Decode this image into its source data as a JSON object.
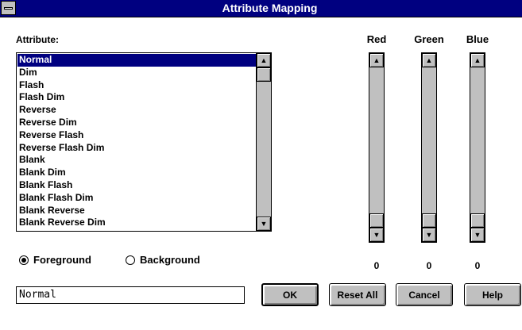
{
  "window": {
    "title": "Attribute Mapping"
  },
  "attribute": {
    "label": "Attribute:",
    "items": [
      "Normal",
      "Dim",
      "Flash",
      "Flash Dim",
      "Reverse",
      "Reverse Dim",
      "Reverse Flash",
      "Reverse Flash Dim",
      "Blank",
      "Blank Dim",
      "Blank Flash",
      "Blank Flash Dim",
      "Blank Reverse",
      "Blank Reverse Dim"
    ],
    "selected_index": 0
  },
  "channels": [
    {
      "label": "Red",
      "value": "0"
    },
    {
      "label": "Green",
      "value": "0"
    },
    {
      "label": "Blue",
      "value": "0"
    }
  ],
  "mode": {
    "foreground_label": "Foreground",
    "background_label": "Background",
    "selected": "Foreground"
  },
  "name_field": {
    "value": "Normal"
  },
  "buttons": {
    "ok": "OK",
    "reset_all": "Reset All",
    "cancel": "Cancel",
    "help": "Help"
  },
  "icons": {
    "scroll_up": "up-arrow-icon",
    "scroll_down": "down-arrow-icon",
    "system_menu": "system-menu-icon"
  }
}
